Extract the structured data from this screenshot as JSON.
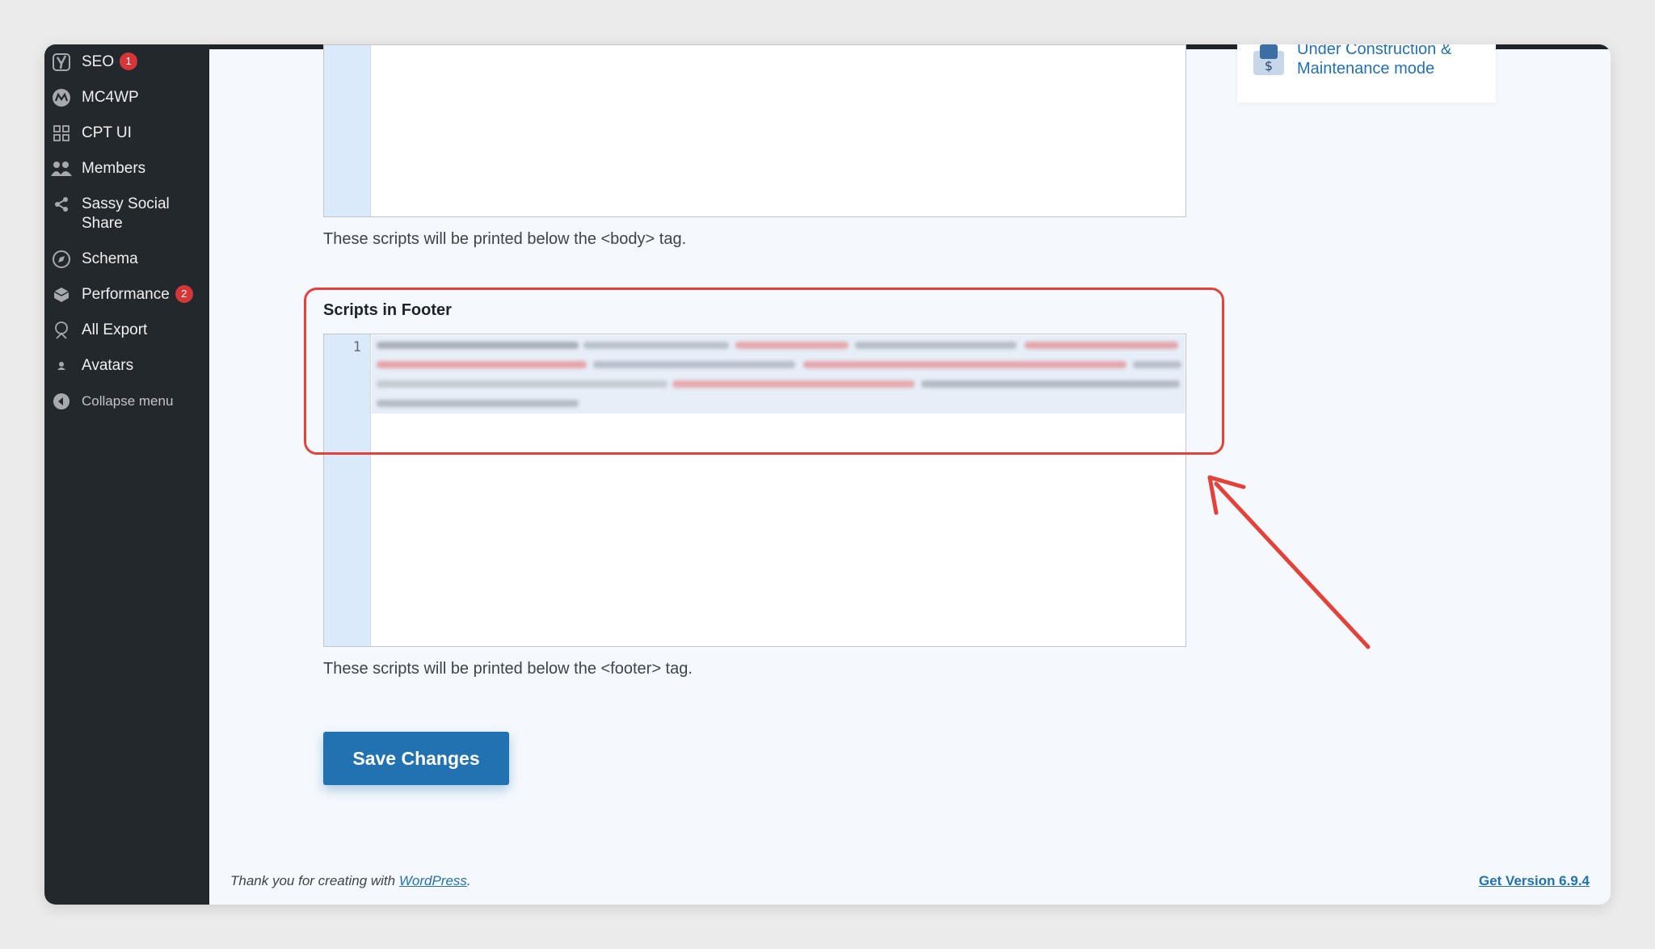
{
  "sidebar": {
    "items": [
      {
        "label": "SEO",
        "icon": "yoast-icon",
        "badge": "1"
      },
      {
        "label": "MC4WP",
        "icon": "mc4wp-icon"
      },
      {
        "label": "CPT UI",
        "icon": "cpt-ui-icon"
      },
      {
        "label": "Members",
        "icon": "members-icon"
      },
      {
        "label_line1": "Sassy Social",
        "label_line2": "Share",
        "icon": "share-icon"
      },
      {
        "label": "Schema",
        "icon": "schema-icon"
      },
      {
        "label": "Performance",
        "icon": "performance-icon",
        "badge": "2"
      },
      {
        "label": "All Export",
        "icon": "export-icon"
      },
      {
        "label": "Avatars",
        "icon": "avatar-icon"
      }
    ],
    "collapse_label": "Collapse menu"
  },
  "body_scripts": {
    "description": "These scripts will be printed below the <body> tag."
  },
  "footer_scripts": {
    "title": "Scripts in Footer",
    "line_number": "1",
    "description": "These scripts will be printed below the <footer> tag."
  },
  "save_button": {
    "label": "Save Changes"
  },
  "plugin_card": {
    "line1": "Under Construction &",
    "line2": "Maintenance mode"
  },
  "footer": {
    "thanks_prefix": "Thank you for creating with ",
    "wordpress_link": "WordPress",
    "thanks_suffix": ".",
    "version_link": "Get Version 6.9.4"
  },
  "colors": {
    "sidebar_bg": "#23282d",
    "accent": "#2271b1",
    "badge": "#d63638",
    "highlight": "#e4413b"
  }
}
